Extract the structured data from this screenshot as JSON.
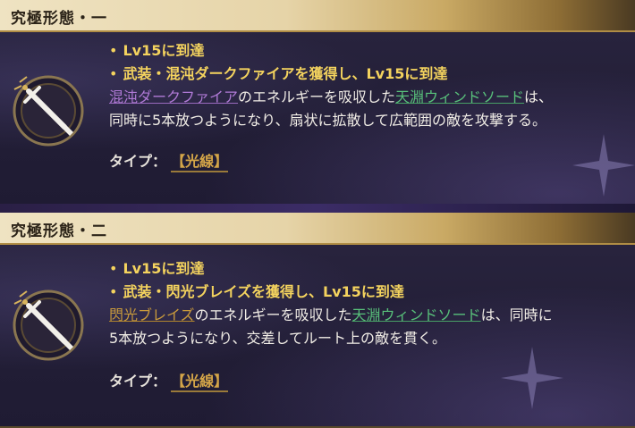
{
  "cards": [
    {
      "title": "究極形態・一",
      "requirements": [
        "Lv15に到達",
        "武装・混沌ダークファイアを獲得し、Lv15に到達"
      ],
      "desc": {
        "weapon": "混沌ダークファイア",
        "text1": "のエネルギーを吸収した",
        "sword": "天淵ウィンドソード",
        "text2": "は、",
        "line2": "同時に5本放つようになり、扇状に拡散して広範囲の敵を攻撃する。"
      },
      "type_label": "タイプ：",
      "type_value": "【光線】"
    },
    {
      "title": "究極形態・二",
      "requirements": [
        "Lv15に到達",
        "武装・閃光ブレイズを獲得し、Lv15に到達"
      ],
      "desc": {
        "weapon": "閃光ブレイズ",
        "text1": "のエネルギーを吸収した",
        "sword": "天淵ウィンドソード",
        "text2": "は、同時に",
        "line2": "5本放つようになり、交差してルート上の敵を貫く。"
      },
      "type_label": "タイプ：",
      "type_value": "【光線】"
    }
  ],
  "colors": {
    "requirement": "#f4d35e",
    "weapon_dark": "#b07ad6",
    "weapon_flash": "#c99a3c",
    "sword": "#58c07a",
    "type_value": "#d4a548"
  },
  "icons": [
    "sword-emblem-icon",
    "sparkle-icon"
  ]
}
